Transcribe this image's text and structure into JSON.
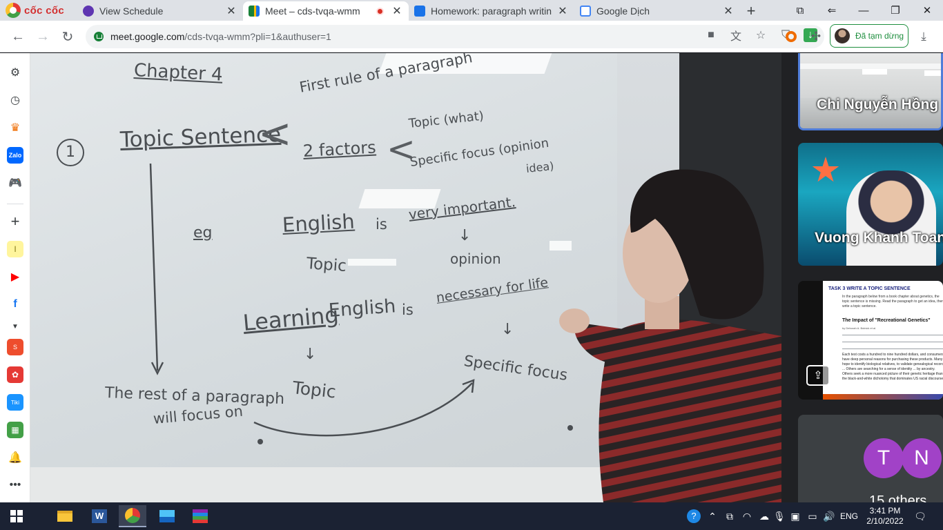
{
  "browser": {
    "brand": "cốc cốc",
    "tabs": [
      {
        "title": "View Schedule",
        "icon": "compass-icon",
        "active": false
      },
      {
        "title": "Meet – cds-tvqa-wmm",
        "icon": "meet-icon",
        "active": true,
        "recording": true
      },
      {
        "title": "Homework: paragraph writin",
        "icon": "classroom-icon",
        "active": false
      },
      {
        "title": "Google Dịch",
        "icon": "translate-icon",
        "active": false
      }
    ],
    "new_tab_label": "+",
    "url_host": "meet.google.com",
    "url_path": "/cds-tvqa-wmm?pli=1&authuser=1",
    "profile_status": "Đã tạm dừng"
  },
  "meet": {
    "whiteboard": {
      "chapter": "Chapter 4",
      "first_rule": "First rule of a paragraph",
      "number": "1",
      "topic_sentence": "Topic Sentence",
      "two_factors": "2 factors",
      "topic_what": "Topic (what)",
      "specific_focus_1": "Specific focus (opinion",
      "idea": "idea)",
      "eg": "eg",
      "english": "English",
      "is": "is",
      "very_important": "very important.",
      "topic_label": "Topic",
      "opinion": "opinion",
      "learning": "Learning",
      "english_2": "English",
      "is_2": "is",
      "necessary": "necessary for life",
      "topic_label_2": "Topic",
      "specific_focus_2": "Specific focus",
      "rest_1": "The rest of a paragraph",
      "rest_2": "will focus on"
    },
    "participants": [
      {
        "name": "Chi Nguyễn Hồng"
      },
      {
        "name": "Vuong Khanh Toan"
      }
    ],
    "shared_doc": {
      "task": "TASK 3 WRITE A TOPIC SENTENCE",
      "intro": "In the paragraph below from a book chapter about genetics, the topic sentence is missing. Read the paragraph to get an idea, then write a topic sentence.",
      "title": "The Impact of \"Recreational Genetics\"",
      "author": "by Deborah A. Bolnick et al.",
      "body": "Each test costs a hundred to nine hundred dollars, and consumers have deep personal reasons for purchasing these products. Many hope to identify biological relatives, to validate genealogical records ... Others are searching for a sense of identity ... by ancestry. Others seek a more nuanced picture of their genetic heritage than the black-and-white dichotomy that dominates US racial discourse."
    },
    "others": {
      "initials": [
        "T",
        "N"
      ],
      "label": "15 others"
    }
  },
  "taskbar": {
    "time": "3:41 PM",
    "date": "2/10/2022",
    "lang": "ENG"
  }
}
